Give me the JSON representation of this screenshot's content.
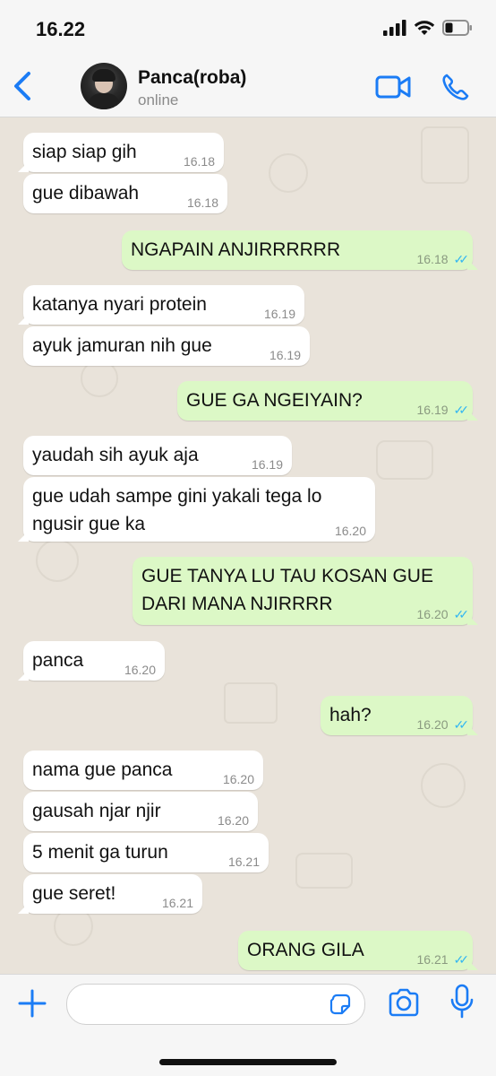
{
  "status_bar": {
    "time": "16.22",
    "battery_level": 0.35
  },
  "header": {
    "contact_name": "Panca(roba)",
    "contact_status": "online"
  },
  "colors": {
    "accent": "#1b7cf5",
    "incoming_bubble": "#ffffff",
    "outgoing_bubble": "#dcf8c6",
    "chat_background": "#e9e3da",
    "read_ticks": "#34b7f1"
  },
  "messages": [
    {
      "direction": "in",
      "lines": [
        "siap siap gih"
      ],
      "time": "16.18"
    },
    {
      "direction": "in",
      "lines": [
        "gue dibawah"
      ],
      "time": "16.18"
    },
    {
      "direction": "out",
      "lines": [
        "NGAPAIN ANJIRRRRRR"
      ],
      "time": "16.18",
      "read": true
    },
    {
      "direction": "in",
      "lines": [
        "katanya nyari protein"
      ],
      "time": "16.19"
    },
    {
      "direction": "in",
      "lines": [
        "ayuk jamuran nih gue"
      ],
      "time": "16.19"
    },
    {
      "direction": "out",
      "lines": [
        "GUE GA NGEIYAIN?"
      ],
      "time": "16.19",
      "read": true
    },
    {
      "direction": "in",
      "lines": [
        "yaudah sih ayuk aja"
      ],
      "time": "16.19"
    },
    {
      "direction": "in",
      "lines": [
        "gue udah sampe gini yakali tega lo",
        "ngusir gue ka"
      ],
      "time": "16.20"
    },
    {
      "direction": "out",
      "lines": [
        "GUE TANYA LU TAU KOSAN GUE",
        "DARI MANA NJIRRRR"
      ],
      "time": "16.20",
      "read": true
    },
    {
      "direction": "in",
      "lines": [
        "panca"
      ],
      "time": "16.20"
    },
    {
      "direction": "out",
      "lines": [
        "hah?"
      ],
      "time": "16.20",
      "read": true
    },
    {
      "direction": "in",
      "lines": [
        "nama gue panca"
      ],
      "time": "16.20"
    },
    {
      "direction": "in",
      "lines": [
        "gausah njar njir"
      ],
      "time": "16.20"
    },
    {
      "direction": "in",
      "lines": [
        "5 menit ga turun"
      ],
      "time": "16.21"
    },
    {
      "direction": "in",
      "lines": [
        "gue seret!"
      ],
      "time": "16.21"
    },
    {
      "direction": "out",
      "lines": [
        "ORANG GILA"
      ],
      "time": "16.21",
      "read": true
    }
  ],
  "input_bar": {
    "message_placeholder": "",
    "icons": [
      "plus-icon",
      "sticker-icon",
      "camera-icon",
      "microphone-icon"
    ]
  },
  "nav_icons": [
    "chevron-left-icon",
    "video-call-icon",
    "phone-icon"
  ],
  "status_icons": [
    "signal-icon",
    "wifi-icon",
    "battery-icon"
  ]
}
